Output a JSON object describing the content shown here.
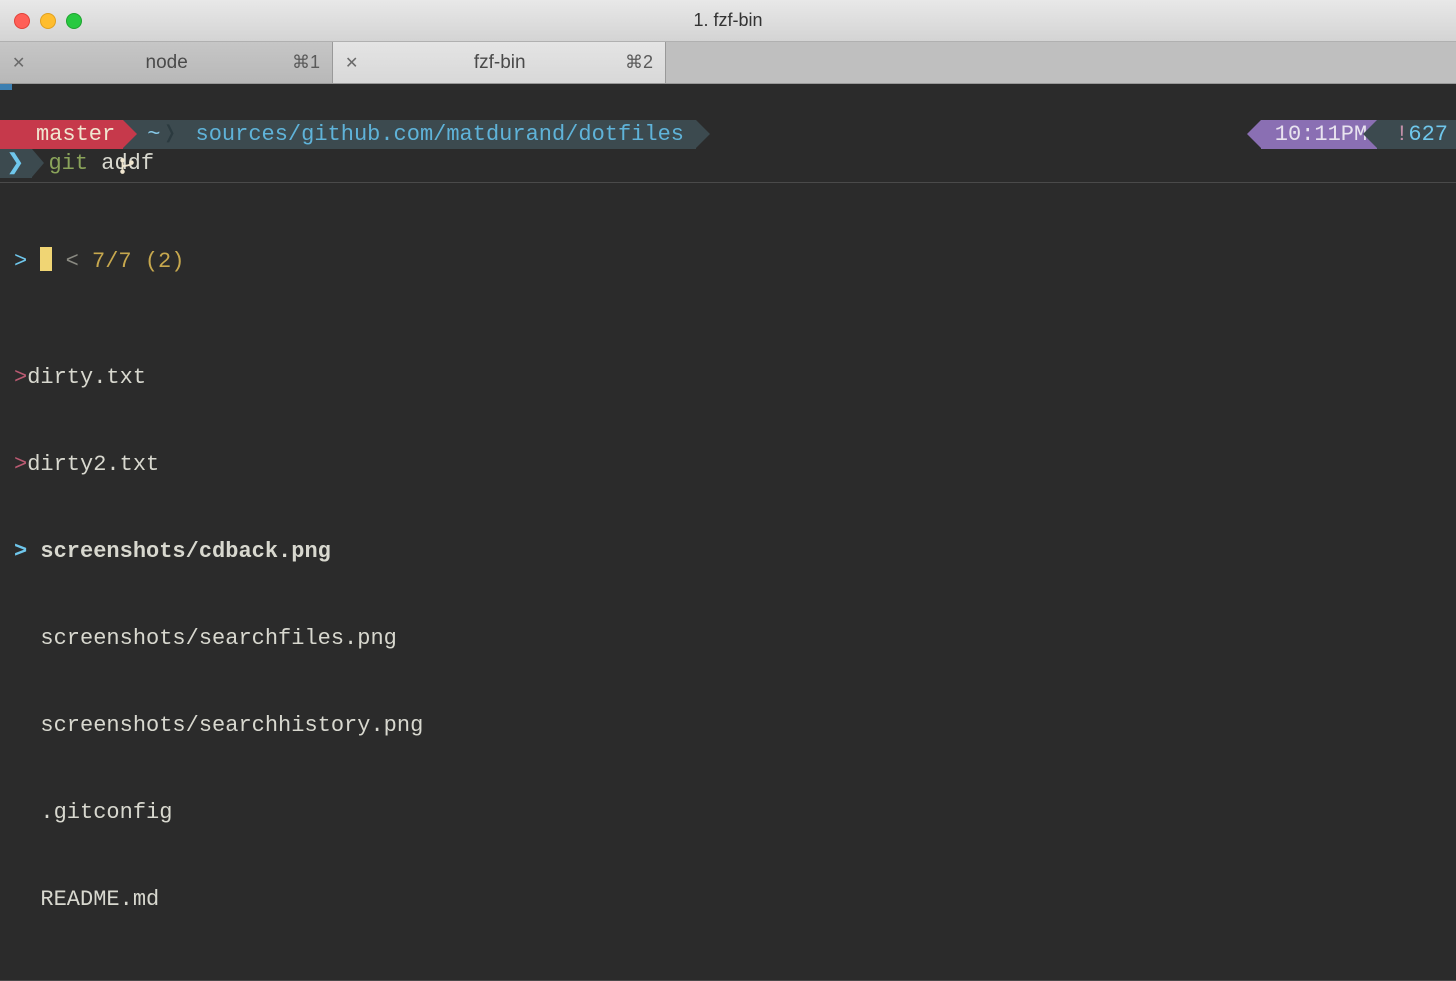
{
  "window": {
    "title": "1. fzf-bin"
  },
  "tabs": [
    {
      "label": "node",
      "shortcut": "⌘1",
      "active": false
    },
    {
      "label": "fzf-bin",
      "shortcut": "⌘2",
      "active": true
    }
  ],
  "prompt": {
    "branch": "master",
    "home": "~",
    "path": "sources/github.com/matdurand/dotfiles",
    "time": "10:11PM",
    "history_bang": "!",
    "history_num": "627"
  },
  "command": {
    "arrow": "❯",
    "git": "git",
    "rest": " addf"
  },
  "fzf": {
    "prompt_left": ">",
    "prompt_right": "<",
    "counter": "7/7",
    "selected_count": "(2)",
    "items": [
      {
        "marker": ">",
        "text": "dirty.txt",
        "selected": true,
        "current": false
      },
      {
        "marker": ">",
        "text": "dirty2.txt",
        "selected": true,
        "current": false
      },
      {
        "marker": ">",
        "text": "screenshots/cdback.png",
        "selected": false,
        "current": true
      },
      {
        "marker": "",
        "text": "screenshots/searchfiles.png",
        "selected": false,
        "current": false
      },
      {
        "marker": "",
        "text": "screenshots/searchhistory.png",
        "selected": false,
        "current": false
      },
      {
        "marker": "",
        "text": ".gitconfig",
        "selected": false,
        "current": false
      },
      {
        "marker": "",
        "text": "README.md",
        "selected": false,
        "current": false
      }
    ]
  }
}
